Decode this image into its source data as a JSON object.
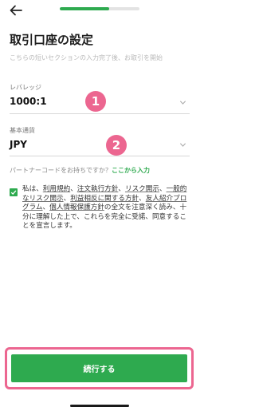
{
  "header": {
    "progress": 0.62,
    "back_icon": "arrow-left-icon"
  },
  "page": {
    "title": "取引口座の設定",
    "subtitle": "こちらの短いセクションの入力完了後、お取引を開始"
  },
  "leverage": {
    "label": "レバレッジ",
    "value": "1000:1"
  },
  "currency": {
    "label": "基本通貨",
    "value": "JPY"
  },
  "annotations": {
    "badge1": "1",
    "badge2": "2",
    "highlight_color": "#ec6690"
  },
  "partner": {
    "question": "パートナーコードをお持ちですか？",
    "link": "ここから入力"
  },
  "agreement": {
    "checked": true,
    "t1": "私は、",
    "l1": "利用規約",
    "t2": "、",
    "l2": "注文執行方針",
    "t3": "、",
    "l3": "リスク開示",
    "t4": "、",
    "l4": "一般的なリスク開示",
    "t5": "、",
    "l5": "利益相反に関する方針",
    "t6": "、",
    "l6": "友人紹介プログラム",
    "t7": "、",
    "l7": "個人情報保護方針",
    "t8": "の全文を注意深く読み、十分に理解した上で、これらを完全に受諾、同意することを宣言します。"
  },
  "cta": {
    "label": "続行する"
  },
  "colors": {
    "accent": "#2eaa4f",
    "annotation": "#ec6690"
  }
}
